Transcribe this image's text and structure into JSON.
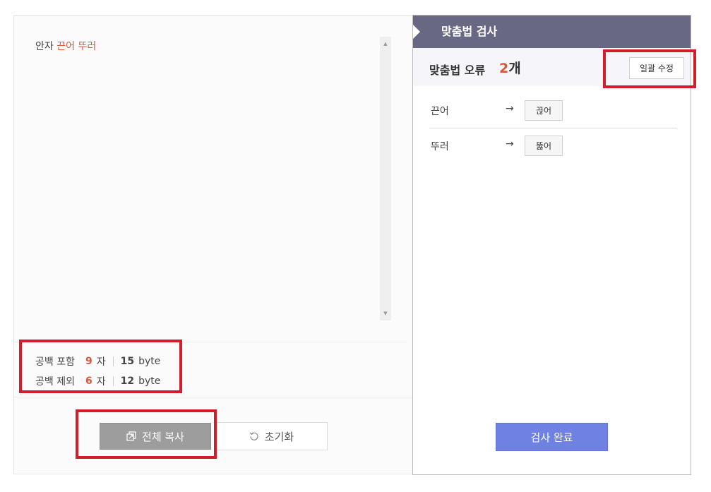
{
  "editor": {
    "text_prefix": "안자 ",
    "error_word_1": "끈어",
    "space": " ",
    "error_word_2": "뚜러"
  },
  "counts": {
    "with_spaces": {
      "label": "공백 포함",
      "chars": "9",
      "char_unit": "자",
      "bytes": "15",
      "byte_unit": "byte"
    },
    "without_spaces": {
      "label": "공백 제외",
      "chars": "6",
      "char_unit": "자",
      "bytes": "12",
      "byte_unit": "byte"
    }
  },
  "buttons": {
    "copy_all": "전체 복사",
    "reset": "초기화",
    "fix_all": "일괄 수정",
    "check_done": "검사 완료"
  },
  "check_panel": {
    "title": "맞춤법 검사",
    "error_label": "맞춤법 오류",
    "error_count": "2",
    "error_count_unit": "개",
    "errors": [
      {
        "wrong": "끈어",
        "arrow": "→",
        "suggestion": "끊어"
      },
      {
        "wrong": "뚜러",
        "arrow": "→",
        "suggestion": "뚫어"
      }
    ]
  },
  "icons": {
    "copy": "copy-icon",
    "reset": "refresh-icon",
    "scroll_up": "triangle-up-icon",
    "scroll_down": "triangle-down-icon"
  },
  "colors": {
    "error_red": "#d9573a",
    "header_bg": "#686884",
    "primary_button": "#6f82e4",
    "highlight_red": "#d01f2a"
  }
}
